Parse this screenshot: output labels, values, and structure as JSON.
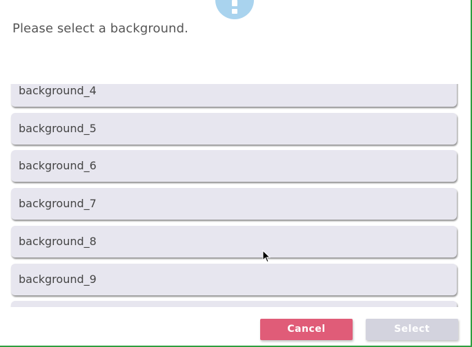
{
  "dialog": {
    "prompt": "Please select a background.",
    "icon": "alert-icon",
    "colors": {
      "frame_accent": "#2e9e3e",
      "badge": "#a9d3ee",
      "item_bg": "#e7e6ef",
      "cancel_bg": "#e05c78",
      "select_disabled_bg": "#d3d3de"
    }
  },
  "list": {
    "items": [
      {
        "label": "background_4"
      },
      {
        "label": "background_5"
      },
      {
        "label": "background_6"
      },
      {
        "label": "background_7"
      },
      {
        "label": "background_8"
      },
      {
        "label": "background_9"
      },
      {
        "label": ""
      }
    ]
  },
  "buttons": {
    "cancel_label": "Cancel",
    "select_label": "Select",
    "select_enabled": false
  }
}
